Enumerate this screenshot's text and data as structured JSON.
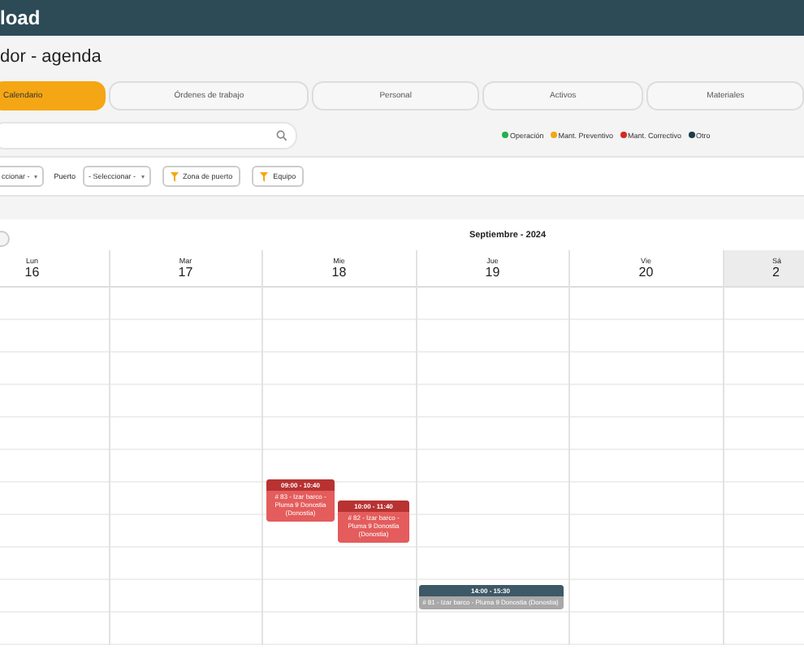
{
  "header": {
    "logo": "load"
  },
  "page_title": "dor - agenda",
  "tabs": [
    {
      "label": "Calendario",
      "selected": true
    },
    {
      "label": "Órdenes de trabajo",
      "selected": false
    },
    {
      "label": "Personal",
      "selected": false
    },
    {
      "label": "Activos",
      "selected": false
    },
    {
      "label": "Materiales",
      "selected": false
    }
  ],
  "legend": [
    {
      "label": "Operación",
      "color": "#22b14c"
    },
    {
      "label": "Mant. Preventivo",
      "color": "#f5a614"
    },
    {
      "label": "Mant. Correctivo",
      "color": "#d42a1e"
    },
    {
      "label": "Otro",
      "color": "#1f3a4a"
    }
  ],
  "filters": {
    "select_1": {
      "value": "ccionar -"
    },
    "port_label": "Puerto",
    "port_select": {
      "value": "- Seleccionar -"
    },
    "buttons": [
      "Zona de puerto",
      "Equipo"
    ]
  },
  "calendar": {
    "title": "Septiembre - 2024",
    "days": [
      {
        "name": "Lun",
        "date": "16",
        "today": false
      },
      {
        "name": "Mar",
        "date": "17",
        "today": false
      },
      {
        "name": "Mie",
        "date": "18",
        "today": false,
        "events": [
          {
            "kind": "correctivo",
            "time": "09:00 - 10:40",
            "text": "# 83 - Izar barco - Pluma 9 Donostia (Donostia)"
          },
          {
            "kind": "correctivo",
            "time": "10:00 - 11:40",
            "text": "# 82 - Izar barco - Pluma 9 Donostia (Donostia)"
          }
        ]
      },
      {
        "name": "Jue",
        "date": "19",
        "today": false,
        "events": [
          {
            "kind": "otro",
            "time": "14:00 - 15:30",
            "text": "# 81 - Izar barco - Pluma 9 Donostia (Donostia)"
          }
        ]
      },
      {
        "name": "Vie",
        "date": "20",
        "today": false
      },
      {
        "name": "Sá",
        "date": "2",
        "today": true
      }
    ]
  }
}
